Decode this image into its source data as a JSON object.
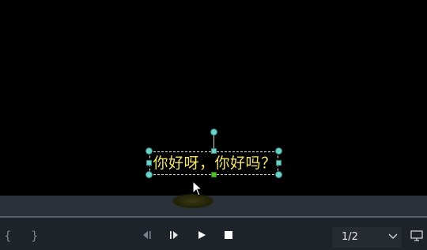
{
  "caption": {
    "text": "你好呀，你好吗？"
  },
  "playback": {
    "page_indicator": "1/2",
    "mark_in_icon": "bracket-open-icon",
    "mark_out_icon": "bracket-close-icon",
    "prev_frame_icon": "step-back-icon",
    "next_frame_icon": "step-forward-icon",
    "play_icon": "play-icon",
    "stop_icon": "stop-icon",
    "dropdown_icon": "chevron-down-icon",
    "display_icon": "monitor-icon",
    "mark_in_glyph": "{",
    "mark_out_glyph": "}"
  },
  "colors": {
    "caption_text": "#f2e56a",
    "handle": "#6fd0c8",
    "anchor": "#4fc02e",
    "toolbar_bg": "#1e2329"
  }
}
